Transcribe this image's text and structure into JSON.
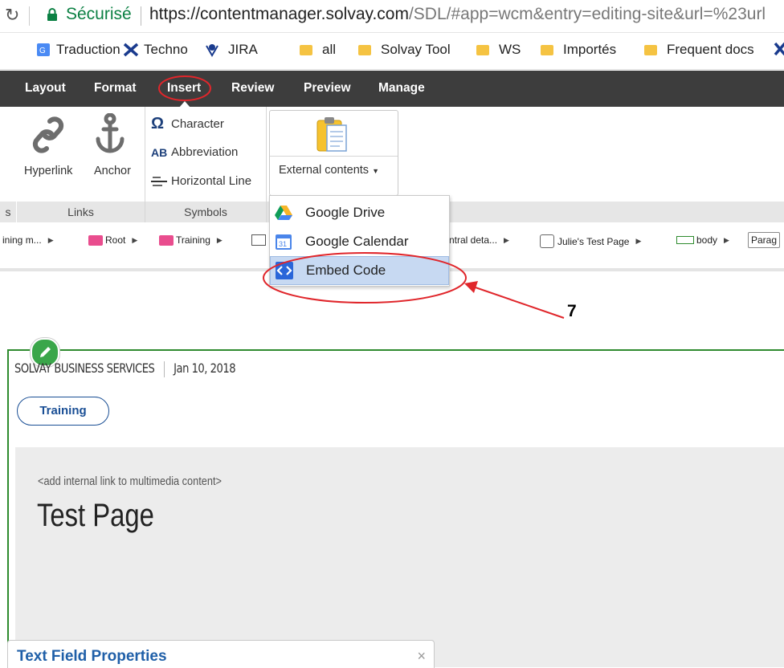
{
  "addressbar": {
    "secure_label": "Sécurisé",
    "url_host": "https://contentmanager.solvay.com",
    "url_rest": "/SDL/#app=wcm&entry=editing-site&url=%23url"
  },
  "bookmarks": [
    "Traduction",
    "Techno",
    "JIRA",
    "all",
    "Solvay Tool",
    "WS",
    "Importés",
    "Frequent docs"
  ],
  "menu": {
    "items": [
      "Layout",
      "Format",
      "Insert",
      "Review",
      "Preview",
      "Manage"
    ],
    "active": "Insert"
  },
  "ribbon": {
    "links_group": {
      "hyperlink": "Hyperlink",
      "anchor": "Anchor",
      "footer": "Links"
    },
    "symbols_group": {
      "character": "Character",
      "abbreviation": "Abbreviation",
      "horizontal_line": "Horizontal Line",
      "footer": "Symbols"
    },
    "external_contents": "External contents",
    "left_footer_fragment": "s"
  },
  "dropdown": {
    "items": [
      {
        "label": "Google Drive",
        "icon": "google-drive-icon"
      },
      {
        "label": "Google Calendar",
        "icon": "google-calendar-icon"
      },
      {
        "label": "Embed Code",
        "icon": "embed-code-icon",
        "selected": true
      }
    ]
  },
  "breadcrumb": {
    "items": [
      "ining m...",
      "Root",
      "Training",
      "ntral deta...",
      "Julie's Test Page",
      "body",
      "Parag"
    ]
  },
  "annotation": {
    "step_number": "7"
  },
  "page": {
    "author": "SOLVAY BUSINESS SERVICES",
    "date": "Jan 10, 2018",
    "tag": "Training",
    "hint": "<add internal link to multimedia content>",
    "title": "Test Page"
  },
  "text_field_panel": {
    "title": "Text Field Properties",
    "close": "×"
  },
  "colors": {
    "menu_bg": "#3d3d3d",
    "frame_green": "#2e8b2e",
    "link_blue": "#1a4f95",
    "annotation_red": "#e0262b"
  }
}
